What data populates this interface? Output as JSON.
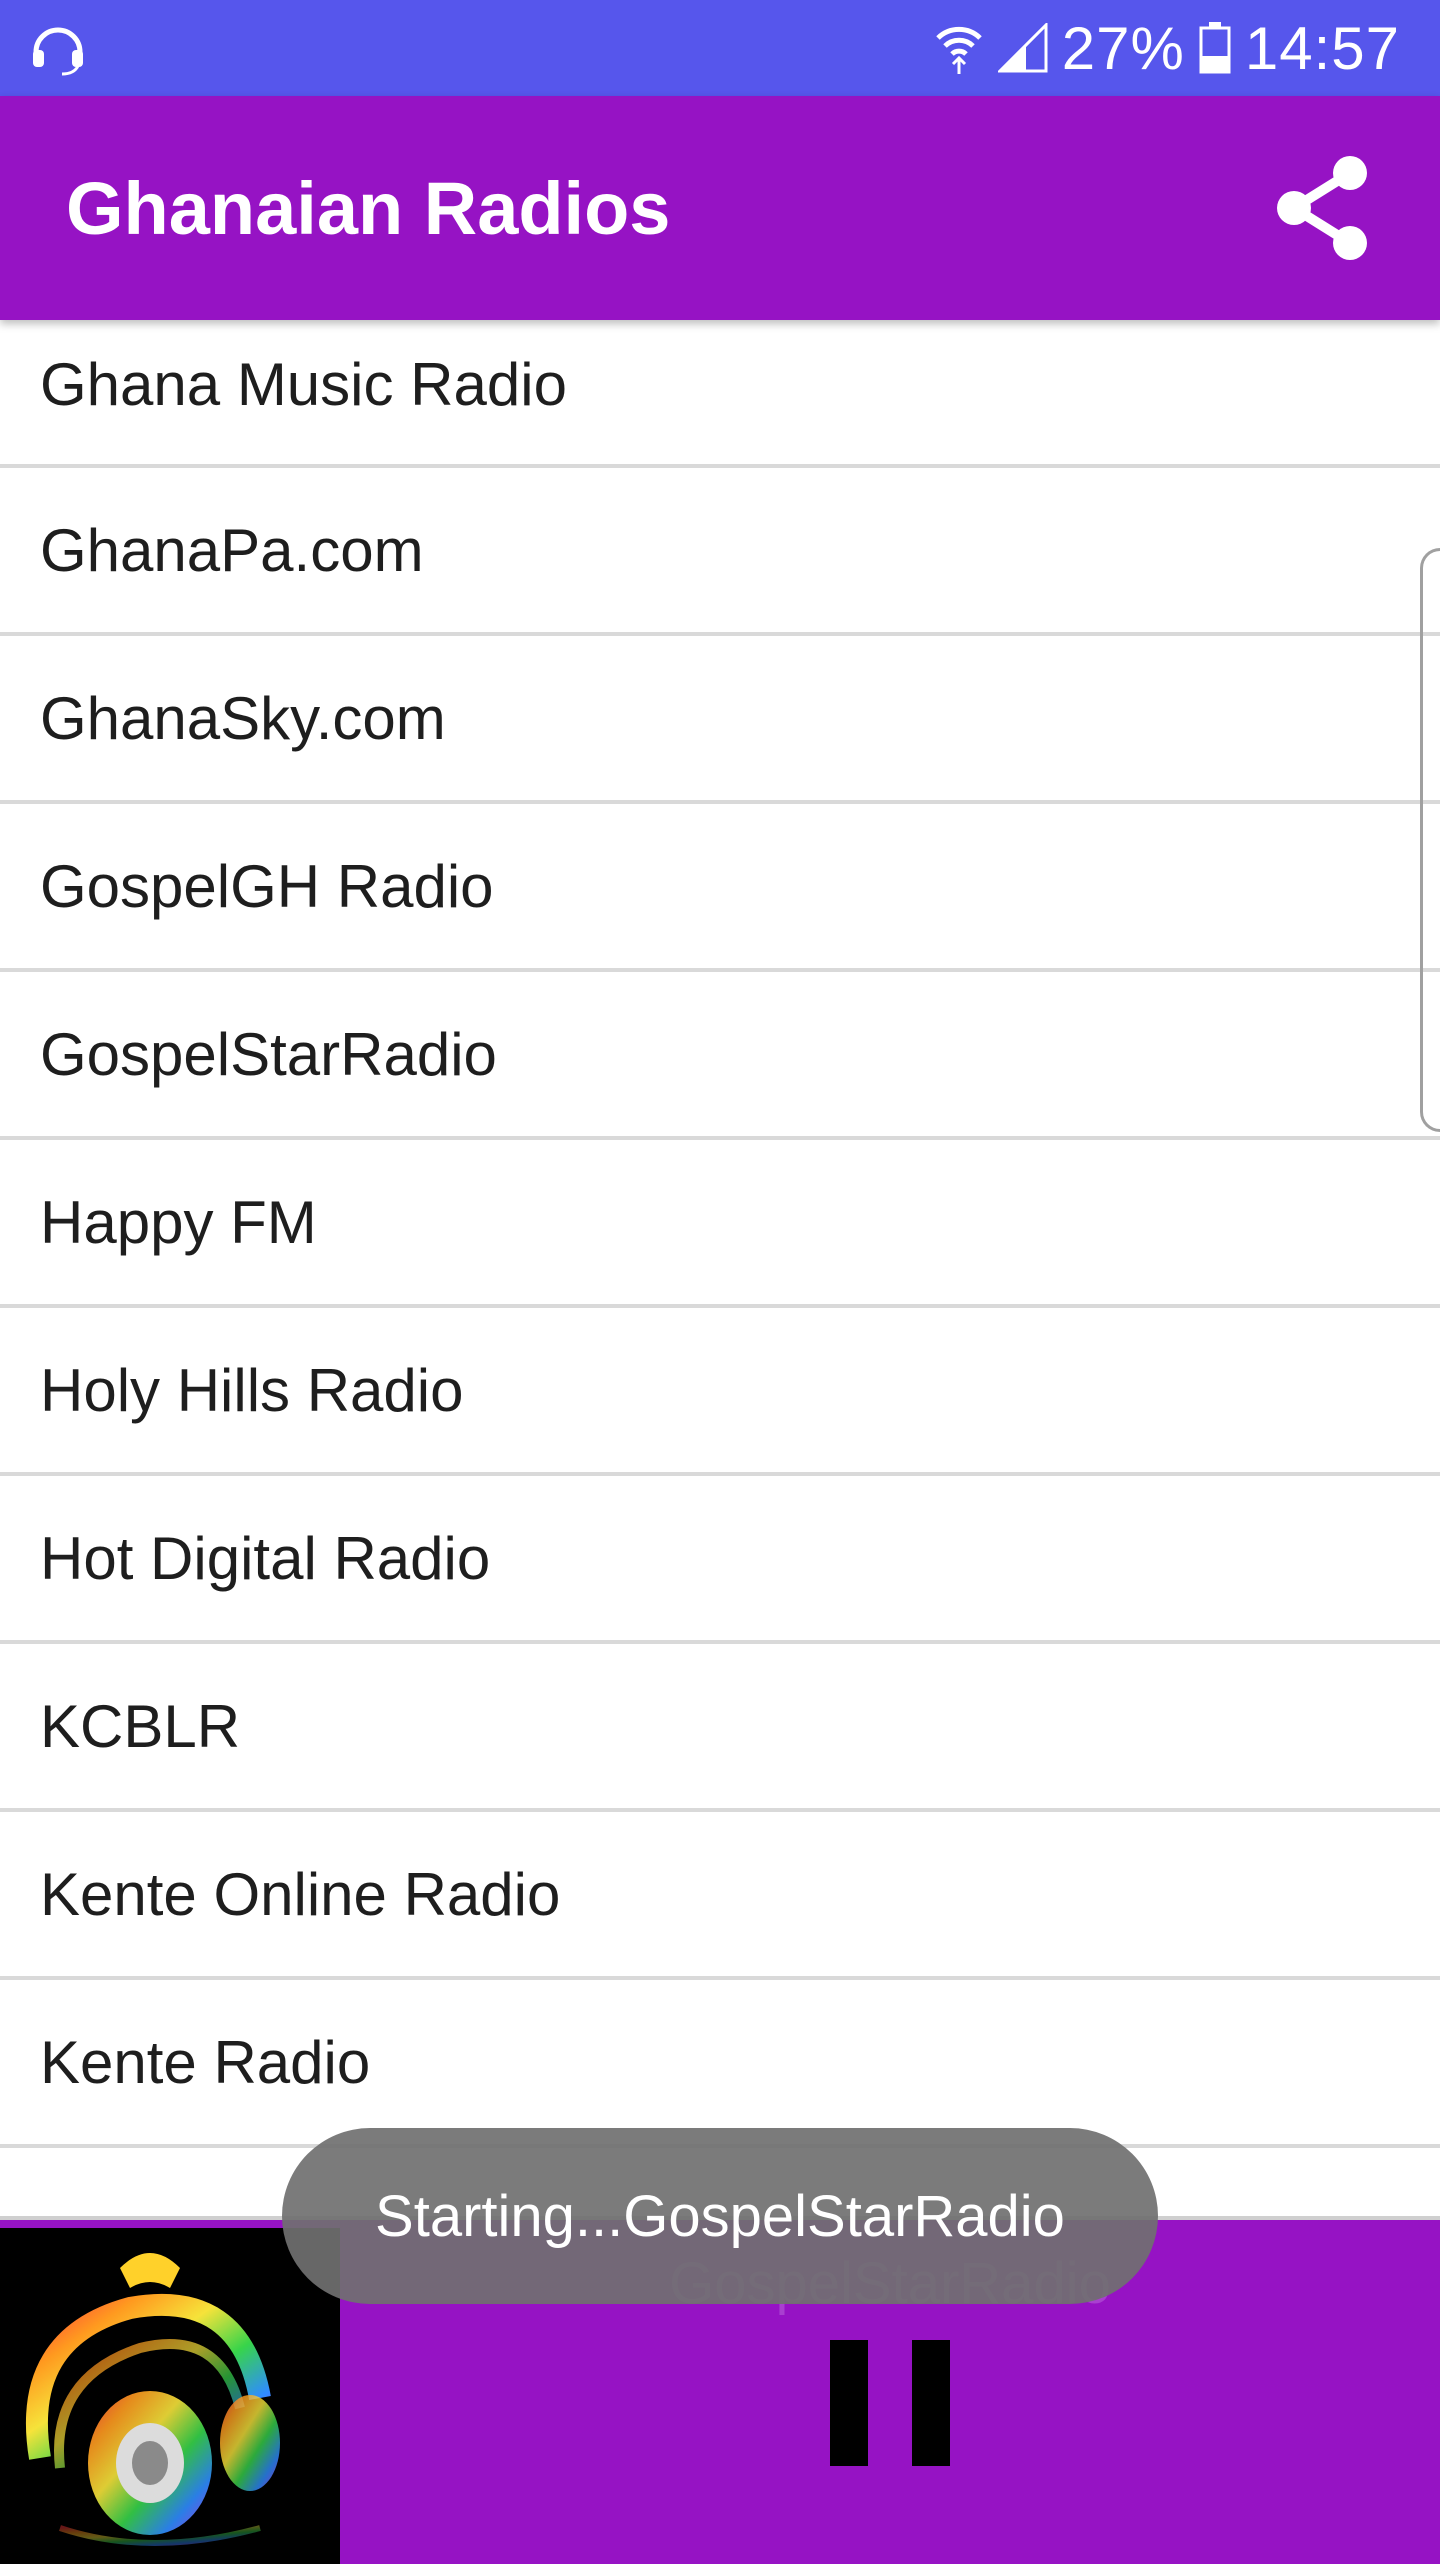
{
  "status_bar": {
    "battery": "27%",
    "time": "14:57",
    "icons": [
      "headset-icon",
      "wifi-icon",
      "signal-icon",
      "battery-icon"
    ]
  },
  "app_bar": {
    "title": "Ghanaian Radios",
    "share_icon": "share-icon",
    "background": "#9613c4"
  },
  "stations": [
    "Ghana Music Radio",
    "GhanaPa.com",
    "GhanaSky.com",
    "GospelGH Radio",
    "GospelStarRadio",
    "Happy FM",
    "Holy Hills Radio",
    "Hot Digital Radio",
    "KCBLR",
    "Kente Online Radio",
    "Kente Radio"
  ],
  "player": {
    "now_playing": "GospelStarRadio",
    "album_art_icon": "headphones-art-icon",
    "control_icon": "pause-icon",
    "background": "#9613c4"
  },
  "toast": {
    "message": "Starting...GospelStarRadio"
  },
  "colors": {
    "status_bar": "#5656ec",
    "accent": "#9613c4",
    "divider": "#d9d9d9"
  }
}
